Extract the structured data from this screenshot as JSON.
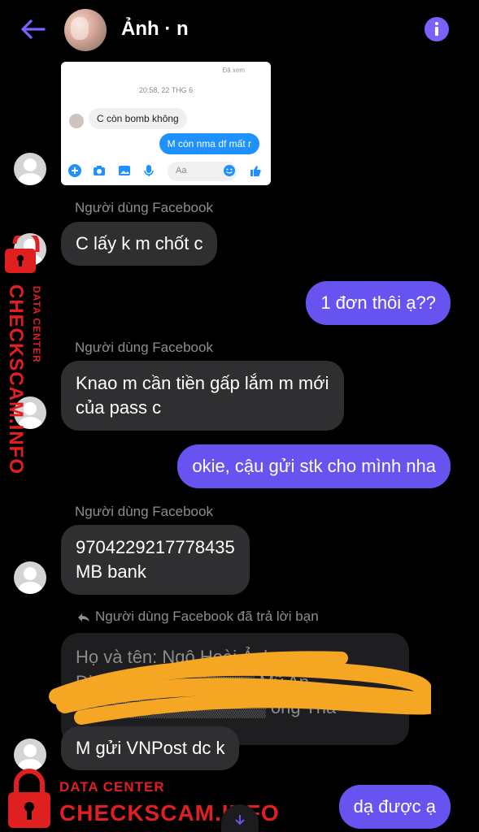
{
  "header": {
    "title": "Ảnh · n"
  },
  "screenshot": {
    "seen": "Đã xem",
    "timestamp": "20:58, 22 THG 6",
    "incoming": "C còn bomb không",
    "outgoing": "M còn nma df mất r",
    "input_placeholder": "Aa"
  },
  "messages": {
    "sender1": "Người dùng Facebook",
    "msg1": "C lấy k m chốt c",
    "out1": "1 đơn thôi ạ??",
    "sender2": "Người dùng Facebook",
    "msg2_line1": "Knao m cần tiền gấp lắm m mới",
    "msg2_line2": "của pass c",
    "out2": "okie, cậu gửi stk cho mình nha",
    "sender3": "Người dùng Facebook",
    "msg3_line1": "9704229217778435",
    "msg3_line2": "MB bank",
    "reply_note": "Người dùng Facebook đã trả lời bạn",
    "quote_line1": "Họ và tên: Ngô Hoài Ảnh",
    "quote_line2": "Địa chỉ: ▒▒▒▒▒▒▒▒▒ Mỹ An,",
    "quote_line3": "▒▒▒▒▒▒▒▒▒▒▒▒▒▒▒ ông Thá",
    "msg4": "M gửi VNPost dc k",
    "out3": "dạ được ạ"
  },
  "watermark": {
    "small": "DATA CENTER",
    "big": "CHECKSCAM.INFO"
  },
  "colors": {
    "accent": "#6753f0",
    "incoming_bubble": "#2f2f31",
    "watermark": "#e02020",
    "scribble": "#f5a623"
  }
}
